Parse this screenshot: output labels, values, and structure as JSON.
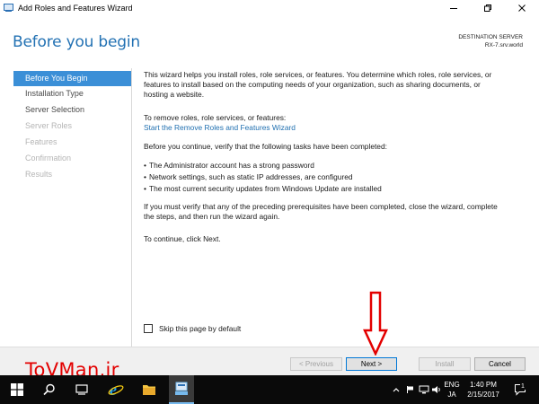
{
  "window": {
    "title": "Add Roles and Features Wizard",
    "controls": [
      "minimize",
      "maximize",
      "close"
    ]
  },
  "header": {
    "page_title": "Before you begin",
    "destination_label": "DESTINATION SERVER",
    "destination_server": "RX-7.srv.world"
  },
  "nav": {
    "items": [
      {
        "label": "Before You Begin",
        "state": "active"
      },
      {
        "label": "Installation Type",
        "state": "enabled"
      },
      {
        "label": "Server Selection",
        "state": "enabled"
      },
      {
        "label": "Server Roles",
        "state": "disabled"
      },
      {
        "label": "Features",
        "state": "disabled"
      },
      {
        "label": "Confirmation",
        "state": "disabled"
      },
      {
        "label": "Results",
        "state": "disabled"
      }
    ]
  },
  "content": {
    "intro_line1": "This wizard helps you install roles, role services, or features. You determine which roles, role services, or",
    "intro_line2": "features to install based on the computing needs of your organization, such as sharing documents, or",
    "intro_line3": "hosting a website.",
    "remove_label": "To remove roles, role services, or features:",
    "remove_link": "Start the Remove Roles and Features Wizard",
    "verify_label": "Before you continue, verify that the following tasks have been completed:",
    "bullets": [
      "The Administrator account has a strong password",
      "Network settings, such as static IP addresses, are configured",
      "The most current security updates from Windows Update are installed"
    ],
    "prereq_line1": "If you must verify that any of the preceding prerequisites have been completed, close the wizard, complete",
    "prereq_line2": "the steps, and then run the wizard again.",
    "continue_text": "To continue, click Next."
  },
  "skip": {
    "label": "Skip this page by default",
    "checked": false
  },
  "buttons": {
    "previous": "< Previous",
    "next": "Next >",
    "install": "Install",
    "cancel": "Cancel"
  },
  "watermark": "ToVMan.ir",
  "taskbar": {
    "language": "ENG",
    "input_mode": "JA",
    "time": "1:40 PM",
    "date": "2/15/2017",
    "notification_count": "1"
  },
  "colors": {
    "accent": "#2271b3",
    "nav_active": "#3b8fd7",
    "link": "#1f6fb0",
    "annotation_arrow": "#e30000"
  }
}
